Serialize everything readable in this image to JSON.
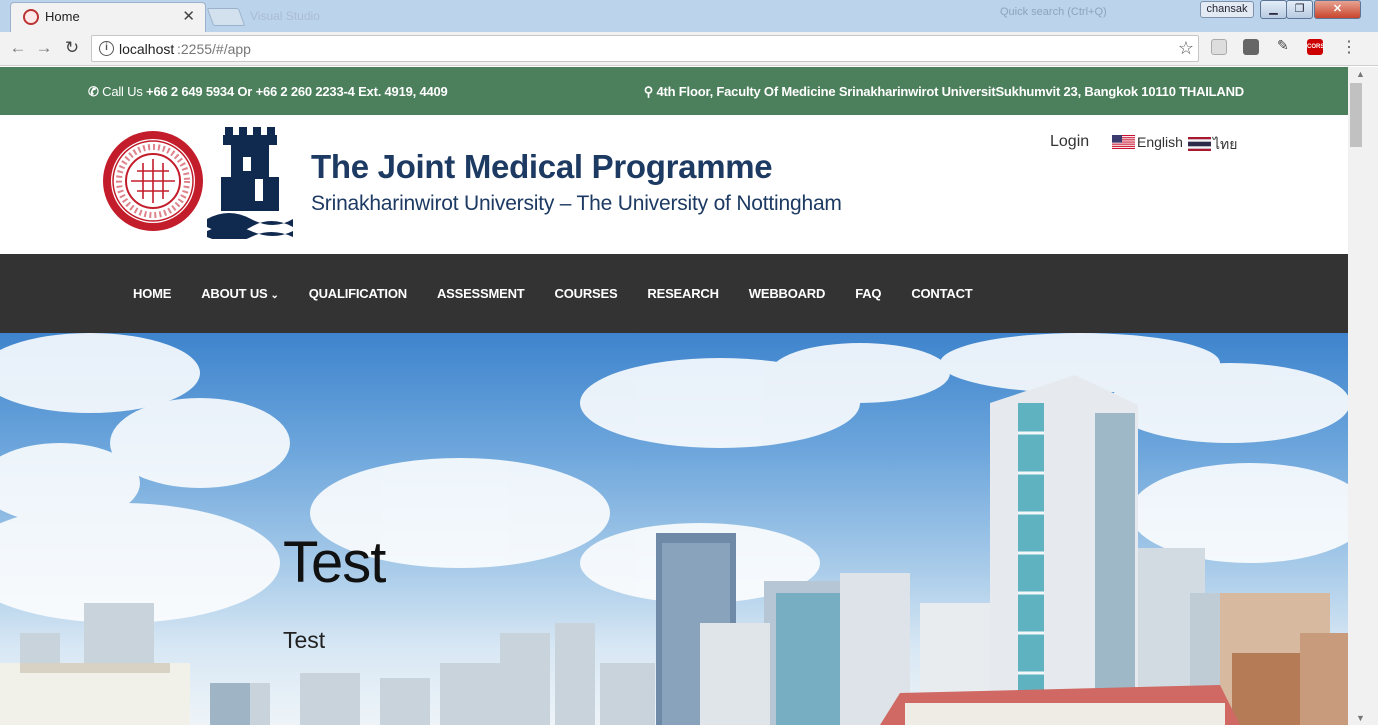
{
  "browser": {
    "tab_title": "Home",
    "url_host": "localhost",
    "url_path": ":2255/#/app",
    "tab_ghost": "Visual Studio",
    "tray_ghost": "Quick search (Ctrl+Q)",
    "user_badge": "chansak",
    "ext_cors": "CORS"
  },
  "topbar": {
    "phone_label": "Call Us",
    "phone_numbers": "+66 2 649 5934 Or +66 2 260 2233-4 Ext. 4919, 4409",
    "address": "4th Floor, Faculty Of Medicine Srinakharinwirot UniversitSukhumvit 23, Bangkok 10110 THAILAND"
  },
  "header": {
    "title": "The Joint Medical Programme",
    "subtitle": "Srinakharinwirot University – The University of Nottingham",
    "login": "Login",
    "lang_en": "English",
    "lang_th": "ไทย"
  },
  "nav": {
    "items": [
      {
        "label": "HOME"
      },
      {
        "label": "ABOUT US"
      },
      {
        "label": "QUALIFICATION"
      },
      {
        "label": "ASSESSMENT"
      },
      {
        "label": "COURSES"
      },
      {
        "label": "RESEARCH"
      },
      {
        "label": "WEBBOARD"
      },
      {
        "label": "FAQ"
      },
      {
        "label": "CONTACT"
      }
    ]
  },
  "hero": {
    "title": "Test",
    "text": "Test"
  },
  "colors": {
    "topbar": "#4c7f5b",
    "nav": "#333333",
    "title": "#1d3a63"
  }
}
